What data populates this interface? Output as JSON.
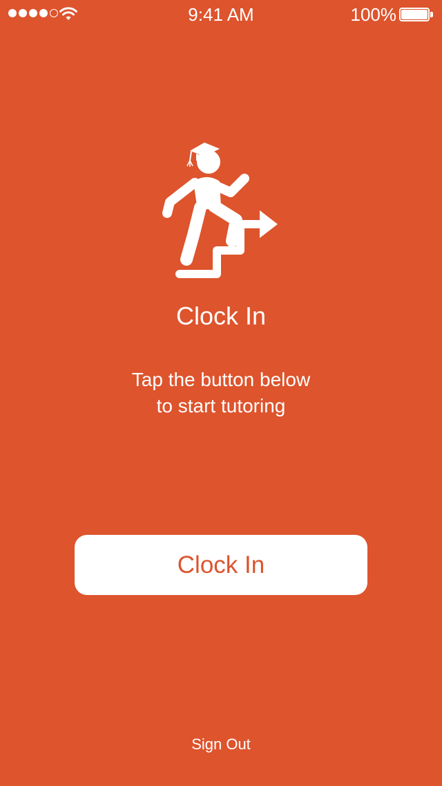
{
  "status_bar": {
    "time": "9:41 AM",
    "battery_percent": "100%",
    "signal_strength": 4,
    "signal_max": 5,
    "wifi_icon": "wifi-icon",
    "battery_icon": "battery-full-icon"
  },
  "hero": {
    "icon": "student-climbing-stairs-icon",
    "title": "Clock In",
    "subtitle_line1": "Tap the button below",
    "subtitle_line2": "to start tutoring"
  },
  "actions": {
    "clock_in_label": "Clock In",
    "sign_out_label": "Sign Out"
  },
  "colors": {
    "background": "#DD542D",
    "foreground": "#FFFFFF",
    "button_background": "#FFFFFF",
    "button_text": "#DD542D"
  }
}
